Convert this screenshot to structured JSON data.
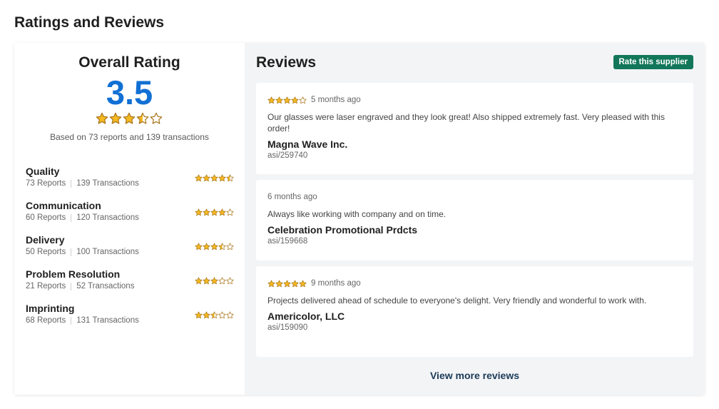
{
  "page": {
    "title": "Ratings and Reviews"
  },
  "overall": {
    "title": "Overall Rating",
    "score": "3.5",
    "score_value": 3.5,
    "based_on": "Based on 73 reports and 139 transactions"
  },
  "categories": [
    {
      "name": "Quality",
      "reports": "73 Reports",
      "transactions": "139 Transactions",
      "rating": 4.5
    },
    {
      "name": "Communication",
      "reports": "60 Reports",
      "transactions": "120 Transactions",
      "rating": 4
    },
    {
      "name": "Delivery",
      "reports": "50 Reports",
      "transactions": "100 Transactions",
      "rating": 3.5
    },
    {
      "name": "Problem Resolution",
      "reports": "21 Reports",
      "transactions": "52 Transactions",
      "rating": 3
    },
    {
      "name": "Imprinting",
      "reports": "68 Reports",
      "transactions": "131 Transactions",
      "rating": 2.5
    }
  ],
  "reviews_panel": {
    "title": "Reviews",
    "rate_button": "Rate this supplier",
    "view_more": "View more reviews"
  },
  "reviews": [
    {
      "rating": 4,
      "date": "5 months ago",
      "text": "Our glasses were laser engraved and they look great! Also shipped extremely fast. Very pleased with this order!",
      "company": "Magna Wave Inc.",
      "asi": "asi/259740"
    },
    {
      "rating": null,
      "date": "6 months ago",
      "text": "Always like working with company and on time.",
      "company": "Celebration Promotional Prdcts",
      "asi": "asi/159668"
    },
    {
      "rating": 5,
      "date": "9 months ago",
      "text": "Projects delivered ahead of schedule to everyone's delight. Very friendly and wonderful to work with.",
      "company": "Americolor, LLC",
      "asi": "asi/159090"
    }
  ],
  "colors": {
    "accent": "#1170d4",
    "button": "#12775a",
    "star_fill": "#f4b921",
    "star_stroke": "#a8741a",
    "panel_bg": "#f3f4f6"
  }
}
